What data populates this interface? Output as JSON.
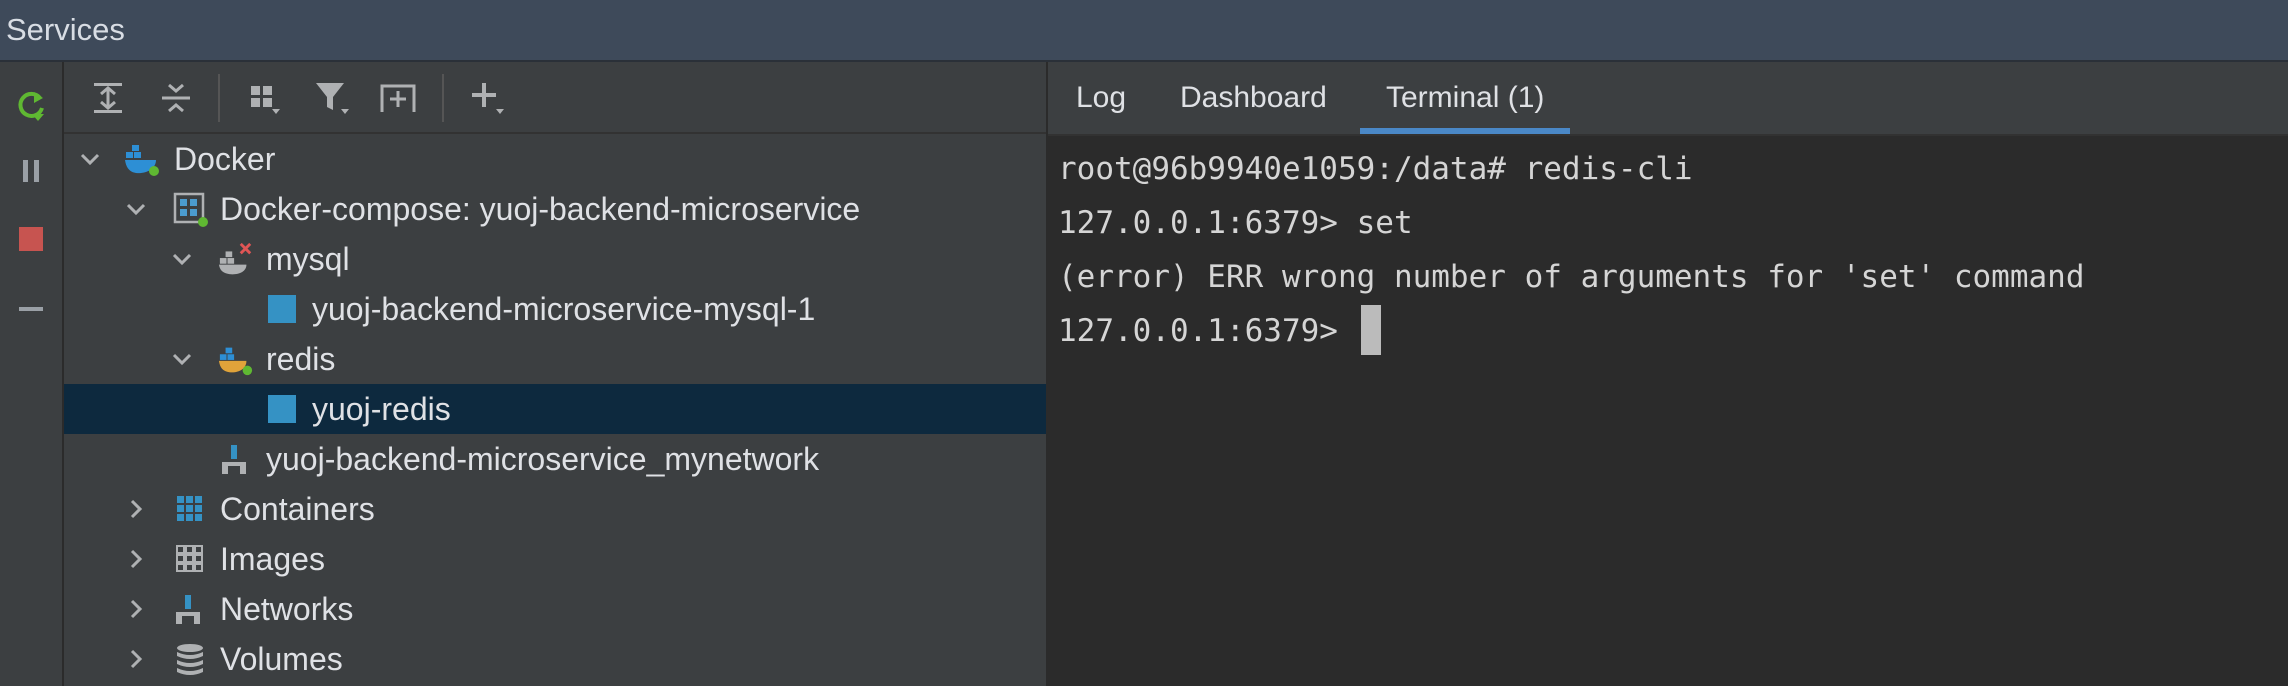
{
  "window": {
    "title": "Services"
  },
  "toolbar": {
    "buttons": [
      "expand-all",
      "collapse-all",
      "group-by",
      "filter",
      "new-service-tab",
      "add-service"
    ]
  },
  "tree": {
    "nodes": [
      {
        "label": "Docker"
      },
      {
        "label": "Docker-compose: yuoj-backend-microservice"
      },
      {
        "label": "mysql"
      },
      {
        "label": "yuoj-backend-microservice-mysql-1"
      },
      {
        "label": "redis"
      },
      {
        "label": "yuoj-redis"
      },
      {
        "label": "yuoj-backend-microservice_mynetwork"
      },
      {
        "label": "Containers"
      },
      {
        "label": "Images"
      },
      {
        "label": "Networks"
      },
      {
        "label": "Volumes"
      }
    ],
    "selected": "yuoj-redis"
  },
  "tabs": {
    "items": [
      {
        "label": "Log"
      },
      {
        "label": "Dashboard"
      },
      {
        "label": "Terminal (1)"
      }
    ],
    "active": "Terminal (1)"
  },
  "terminal": {
    "lines": [
      "root@96b9940e1059:/data# redis-cli",
      "127.0.0.1:6379> set",
      "(error) ERR wrong number of arguments for 'set' command",
      "127.0.0.1:6379> "
    ]
  },
  "colors": {
    "accent": "#4a88c7",
    "selection": "#0d293e",
    "docker_blue": "#2d8fd5",
    "status_green": "#5fb832",
    "status_red": "#e05555",
    "stop_red": "#c75450",
    "refresh_green": "#5fb832"
  }
}
